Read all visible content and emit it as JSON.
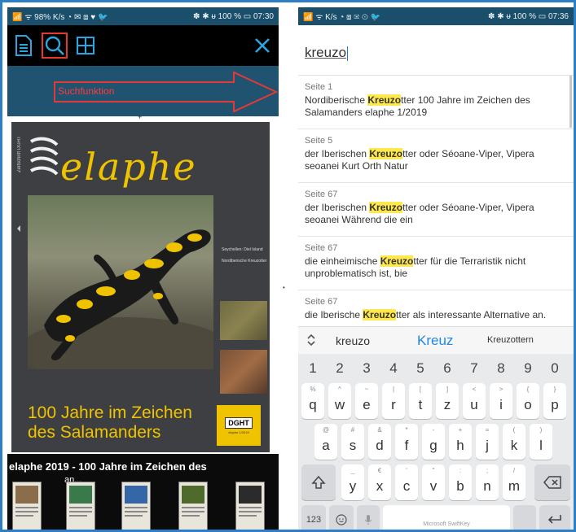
{
  "left": {
    "status_left": "📶 ᯤ 98% K/s ◔ ✉ ⧈ ♥ 🐦",
    "status_right": "✽ ✱ ᵾ 100 % ▭ 07:30",
    "annotation": "Suchfunktion",
    "cover": {
      "side_text": "Zeitschrift DGHT",
      "headline_line1": "100 Jahre im Zeichen",
      "headline_line2": "des Salamanders",
      "right_text": "Seychellen: Diel Island\n\nNordiberische Kreuzotter",
      "dght_logo": "DGHT",
      "dght_sub": "elaphe 1/2019"
    },
    "thumb_title": "elaphe 2019 - 100 Jahre im Zeichen des",
    "thumb_title2": "an...",
    "colors": {
      "annotation": "#ff3b3b",
      "brand_yellow": "#f0c300",
      "toolbar_bg": "#000000"
    }
  },
  "right": {
    "status_left": "📶 ᯤ K/s ◔ ⧈ ✉ ⊙ 🐦",
    "status_right": "✽ ✱ ᵾ 100 % ▭ 07:36",
    "search": {
      "value": "kreuzo"
    },
    "results": [
      {
        "page": "Seite 1",
        "pre": "Nordiberische ",
        "hl": "Kreuzo",
        "post": "tter 100 Jahre im Zeichen des Salamanders elaphe 1/2019"
      },
      {
        "page": "Seite 5",
        "pre": "der Iberischen ",
        "hl": "Kreuzo",
        "post": "tter oder Séoane-Viper, Vipera seoanei Kurt Orth Natur"
      },
      {
        "page": "Seite 67",
        "pre": "der Iberischen ",
        "hl": "Kreuzo",
        "post": "tter oder Séoane-Viper, Vipera seoanei Während die ein"
      },
      {
        "page": "Seite 67",
        "pre": "die einheimische ",
        "hl": "Kreuzo",
        "post": "tter für die Terraristik nicht unproblematisch ist, bie"
      },
      {
        "page": "Seite 67",
        "pre": "die Iberische ",
        "hl": "Kreuzo",
        "post": "tter als interessante Alternative an."
      }
    ],
    "suggestions": [
      "kreuzo",
      "Kreuz",
      "Kreuzottern"
    ],
    "keyboard": {
      "numbers": [
        "1",
        "2",
        "3",
        "4",
        "5",
        "6",
        "7",
        "8",
        "9",
        "0"
      ],
      "row1": [
        [
          "q",
          "%"
        ],
        [
          "w",
          "^"
        ],
        [
          "e",
          "~"
        ],
        [
          "r",
          "|"
        ],
        [
          "t",
          "["
        ],
        [
          "z",
          "]"
        ],
        [
          "u",
          "<"
        ],
        [
          "i",
          ">"
        ],
        [
          "o",
          "{"
        ],
        [
          "p",
          "}"
        ]
      ],
      "row2": [
        [
          "a",
          "@"
        ],
        [
          "s",
          "#"
        ],
        [
          "d",
          "&"
        ],
        [
          "f",
          "*"
        ],
        [
          "g",
          "-"
        ],
        [
          "h",
          "+"
        ],
        [
          "j",
          "="
        ],
        [
          "k",
          "("
        ],
        [
          "l",
          ")"
        ]
      ],
      "row3": [
        [
          "y",
          "_"
        ],
        [
          "x",
          "€"
        ],
        [
          "c",
          "'"
        ],
        [
          "v",
          "\""
        ],
        [
          "b",
          ":"
        ],
        [
          "n",
          ";"
        ],
        [
          "m",
          "/"
        ]
      ],
      "sym_key": "123",
      "space_label": "Microsoft SwiftKey"
    },
    "colors": {
      "highlight": "#ffe84a",
      "accent": "#1e88e5",
      "keyboard_bg": "#e9eaec"
    }
  }
}
